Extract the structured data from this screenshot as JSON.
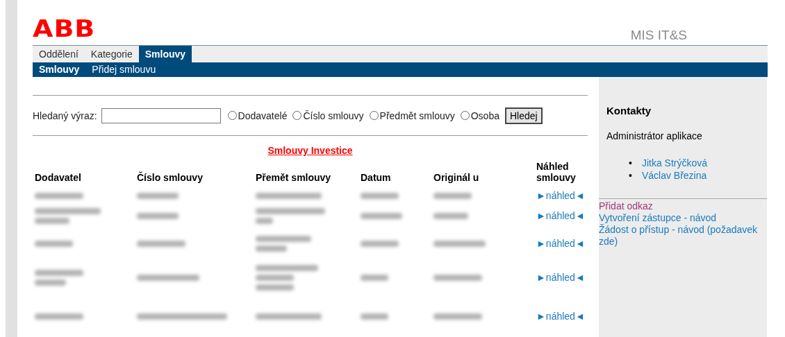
{
  "header": {
    "logo": "ABB",
    "app_title": "MIS IT&S"
  },
  "tabs": [
    {
      "label": "Oddělení",
      "selected": false
    },
    {
      "label": "Kategorie",
      "selected": false
    },
    {
      "label": "Smlouvy",
      "selected": true
    }
  ],
  "subnav": [
    {
      "label": "Smlouvy",
      "selected": true
    },
    {
      "label": "Přidej smlouvu",
      "selected": false
    }
  ],
  "search": {
    "label": "Hledaný výraz:",
    "options": [
      {
        "label": "Dodavatelé",
        "selected": false
      },
      {
        "label": "Číslo smlouvy",
        "selected": false
      },
      {
        "label": "Předmět smlouvy",
        "selected": false
      },
      {
        "label": "Osoba",
        "selected": false
      }
    ],
    "button": "Hledej"
  },
  "table": {
    "title": "Smlouvy Investice",
    "columns": [
      "Dodavatel",
      "Číslo smlouvy",
      "Přemět smlouvy",
      "Datum",
      "Originál u",
      "Náhled smlouvy"
    ],
    "rows": [
      {
        "preview": "►náhled◄"
      },
      {
        "preview": "►náhled◄"
      },
      {
        "preview": "►náhled◄"
      },
      {
        "preview": "►náhled◄"
      },
      {
        "preview": "►náhled◄"
      }
    ]
  },
  "sidebar": {
    "title": "Kontakty",
    "subtitle": "Administrátor aplikace",
    "contacts": [
      {
        "bullet": "•",
        "name": "Jitka Strýčková"
      },
      {
        "bullet": "•",
        "name": "Václav Březina"
      }
    ],
    "links": [
      {
        "label": "Přidat odkaz",
        "visited": true
      },
      {
        "label": "Vytvoření zástupce - návod",
        "visited": false
      },
      {
        "label": "Žádost o přístup - návod (požadavek zde)",
        "visited": false
      }
    ]
  }
}
